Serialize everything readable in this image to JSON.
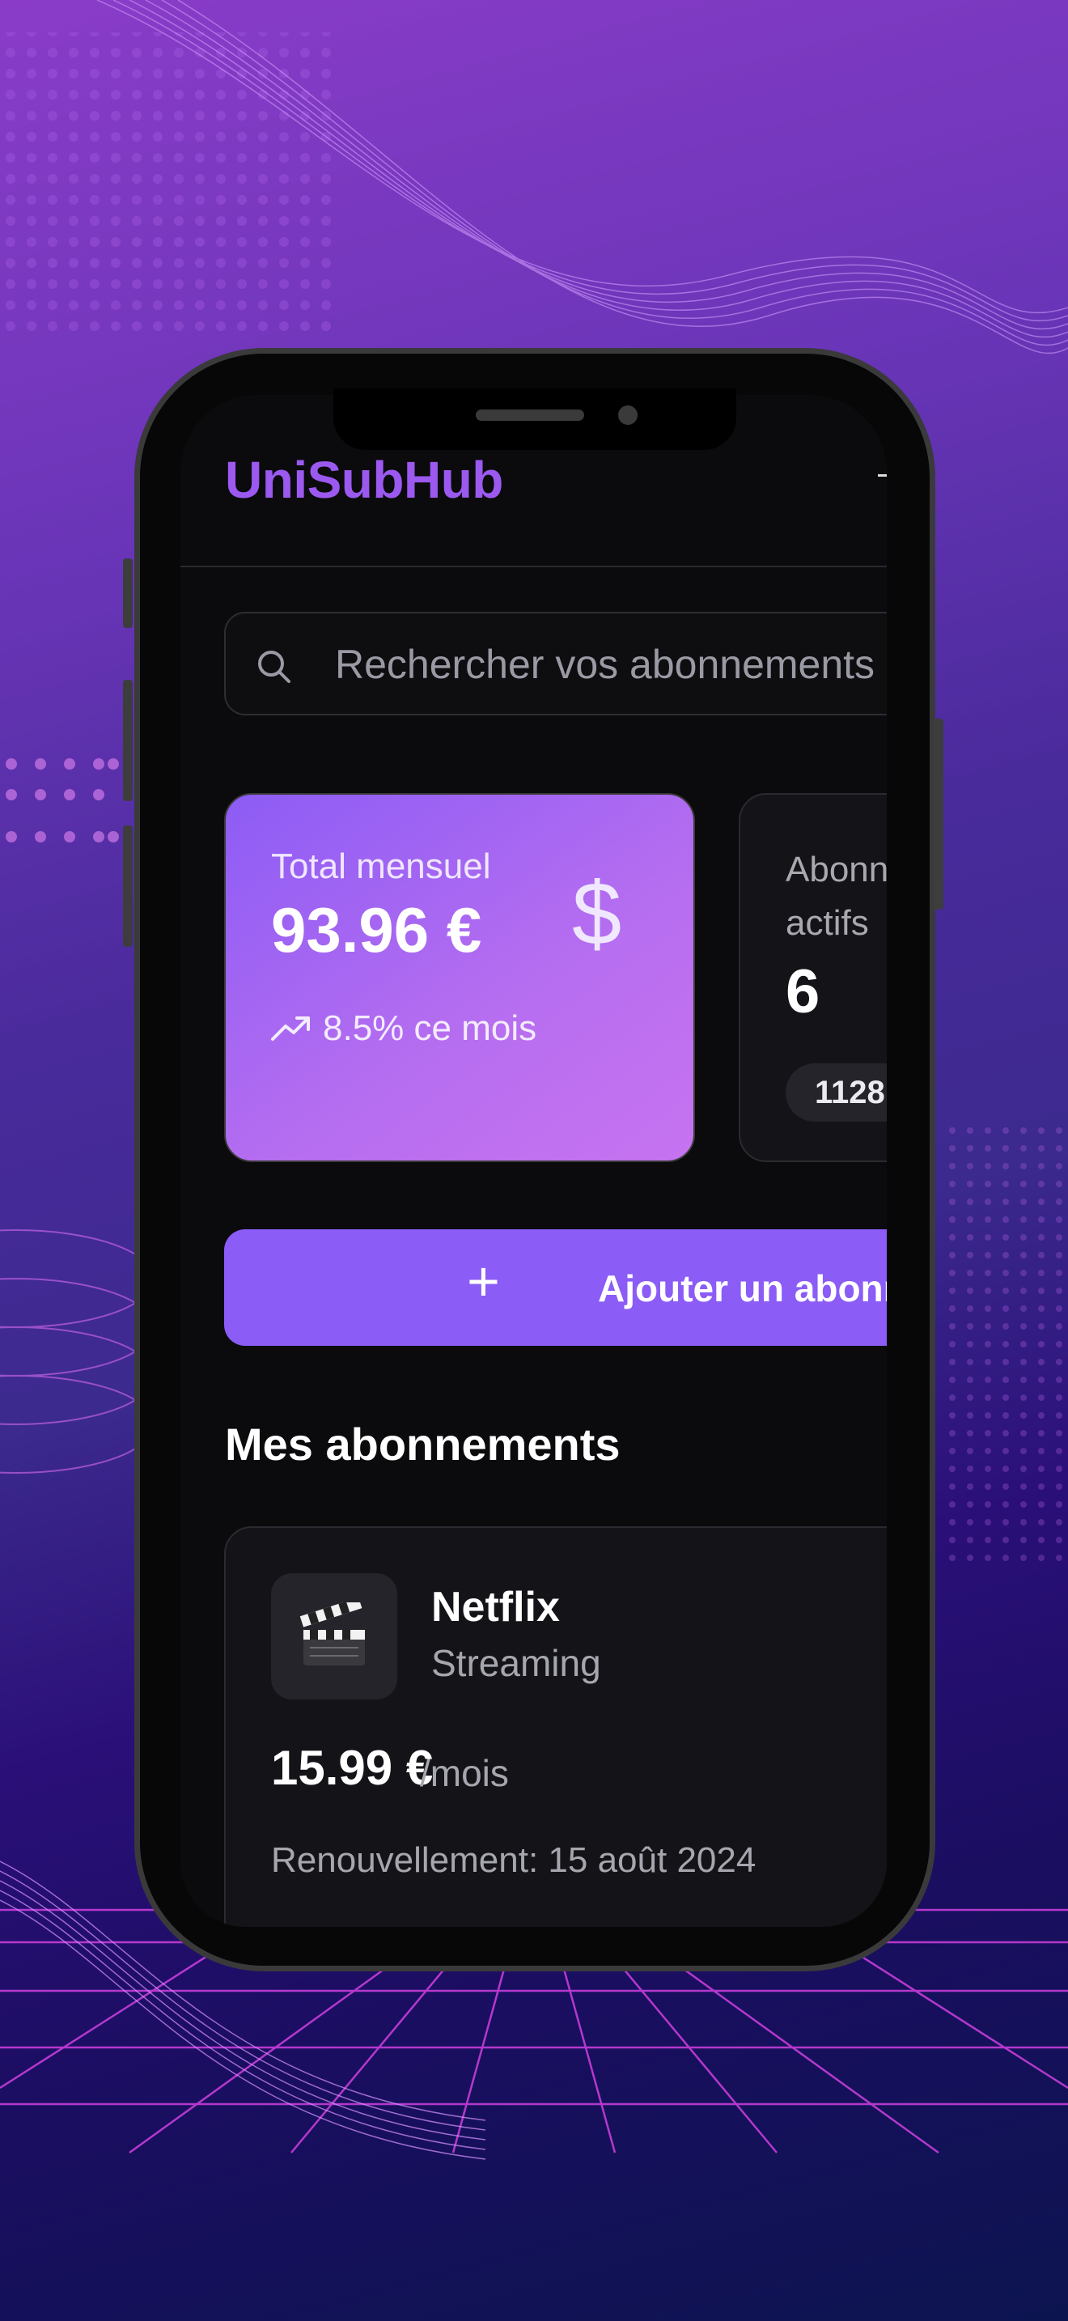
{
  "app": {
    "title": "UniSubHub"
  },
  "search": {
    "placeholder": "Rechercher vos abonnements"
  },
  "stats": {
    "total": {
      "label": "Total mensuel",
      "amount": "93.96 €",
      "currency_icon": "dollar-icon",
      "trend": "8.5% ce mois"
    },
    "active": {
      "label": "Abonnements actifs",
      "count": "6",
      "badge": "1128"
    }
  },
  "actions": {
    "add_label": "Ajouter un abonnement"
  },
  "section": {
    "title": "Mes abonnements"
  },
  "subscriptions": [
    {
      "name": "Netflix",
      "category": "Streaming",
      "price": "15.99 €",
      "period": "/mois",
      "renewal": "Renouvellement: 15 août 2024",
      "icon": "clapperboard-icon"
    }
  ],
  "colors": {
    "accent": "#8b5cf6",
    "brand": "#9b59f0",
    "screen_bg": "#0b0b0d",
    "card_bg": "#141418"
  }
}
